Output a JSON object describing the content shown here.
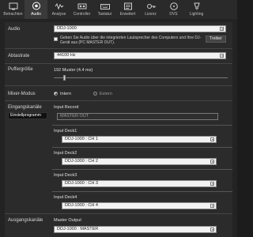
{
  "toolbar": {
    "items": [
      {
        "label": "Betrachten",
        "icon": "view-icon"
      },
      {
        "label": "Audio",
        "icon": "speaker-icon"
      },
      {
        "label": "Analyse",
        "icon": "analysis-icon"
      },
      {
        "label": "Controller",
        "icon": "controller-icon"
      },
      {
        "label": "Tastatur",
        "icon": "keyboard-icon"
      },
      {
        "label": "Erweitert",
        "icon": "advanced-icon"
      },
      {
        "label": "Lizenz",
        "icon": "license-icon"
      },
      {
        "label": "DVS",
        "icon": "dvs-icon"
      },
      {
        "label": "Lighting",
        "icon": "lighting-icon"
      }
    ],
    "active_index": 1
  },
  "audio": {
    "label": "Audio",
    "device": "DDJ-1000",
    "passthrough_text": "Geben Sie Audio über die integrierten Lautsprecher des Computers und Ihre DJ-Gerät aus (PC MASTER OUT).",
    "driver_button": "Treiber"
  },
  "sample_rate": {
    "label": "Abtastrate",
    "value": "44100 Hz"
  },
  "buffer": {
    "label": "Puffergröße",
    "value": "192 Muster (4.4 ms)",
    "level_fraction": 0.06
  },
  "mixer": {
    "label": "Mixer-Modus",
    "options": [
      "Intern",
      "Extern"
    ],
    "selected": "Intern"
  },
  "inputs": {
    "label": "Eingangskanäle",
    "setup_button": "Einstellprogramm",
    "record_label": "Input Record",
    "record_value": "MASTER OUT",
    "decks": [
      {
        "label": "Input Deck1",
        "value": "DDJ-1000 : CH 1"
      },
      {
        "label": "Input Deck2",
        "value": "DDJ-1000 : CH 2"
      },
      {
        "label": "Input Deck3",
        "value": "DDJ-1000 : CH 3"
      },
      {
        "label": "Input Deck4",
        "value": "DDJ-1000 : CH 4"
      }
    ]
  },
  "outputs": {
    "label": "Ausgangskanäle",
    "master_label": "Master Output",
    "master_value": "DDJ-1000 : MASTER"
  }
}
